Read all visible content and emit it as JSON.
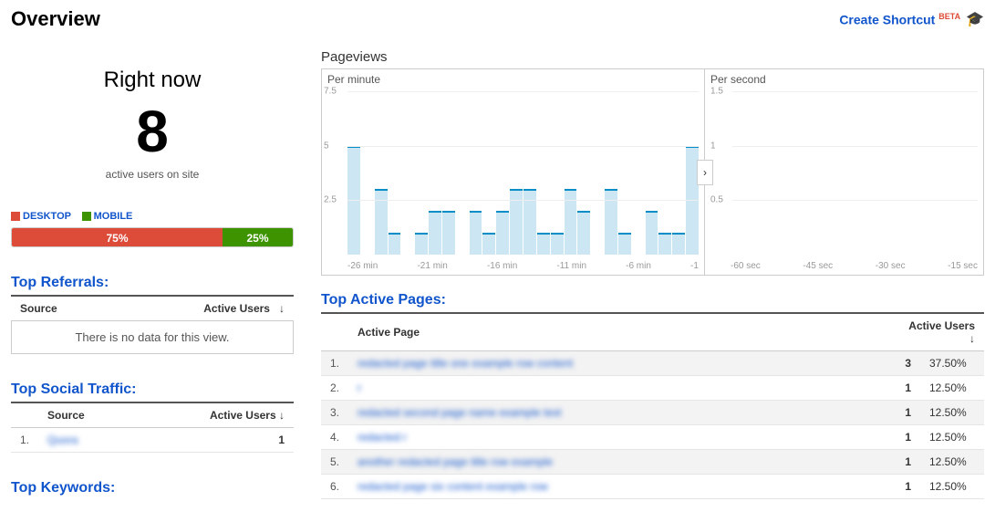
{
  "header": {
    "title": "Overview",
    "shortcut_label": "Create Shortcut",
    "beta_label": "BETA"
  },
  "rightnow": {
    "title": "Right now",
    "value": "8",
    "subtitle": "active users on site"
  },
  "platform": {
    "desktop_label": "DESKTOP",
    "mobile_label": "MOBILE",
    "desktop_pct": "75%",
    "mobile_pct": "25%",
    "desktop_width": 75,
    "mobile_width": 25
  },
  "sections": {
    "referrals": "Top Referrals:",
    "social": "Top Social Traffic:",
    "keywords": "Top Keywords:",
    "active_pages": "Top Active Pages:"
  },
  "columns": {
    "source": "Source",
    "active_users": "Active Users",
    "active_page": "Active Page",
    "sort_arrow": "↓"
  },
  "referrals": {
    "no_data": "There is no data for this view."
  },
  "social": {
    "rows": [
      {
        "idx": "1.",
        "source": "Quora",
        "users": "1"
      }
    ]
  },
  "charts": {
    "title": "Pageviews",
    "per_minute": "Per minute",
    "per_second": "Per second",
    "expand": "›"
  },
  "chart_data": [
    {
      "type": "bar",
      "title": "Per minute",
      "xlabel": "min",
      "ylabel": "",
      "ylim": [
        0,
        7.5
      ],
      "yticks": [
        2.5,
        5.0,
        7.5
      ],
      "xticks": [
        "-26 min",
        "-21 min",
        "-16 min",
        "-11 min",
        "-6 min",
        "-1"
      ],
      "values": [
        5,
        0,
        3,
        1,
        0,
        1,
        2,
        2,
        0,
        2,
        1,
        2,
        3,
        3,
        1,
        1,
        3,
        2,
        0,
        3,
        1,
        0,
        2,
        1,
        1,
        5
      ]
    },
    {
      "type": "bar",
      "title": "Per second",
      "xlabel": "sec",
      "ylabel": "",
      "ylim": [
        0,
        1.5
      ],
      "yticks": [
        0.5,
        1,
        1.5
      ],
      "xticks": [
        "-60 sec",
        "-45 sec",
        "-30 sec",
        "-15 sec"
      ],
      "values": []
    }
  ],
  "active_pages": {
    "rows": [
      {
        "idx": "1.",
        "page": "redacted page title one example row content",
        "users": "3",
        "pct": "37.50%"
      },
      {
        "idx": "2.",
        "page": "r",
        "users": "1",
        "pct": "12.50%"
      },
      {
        "idx": "3.",
        "page": "redacted second page name example text",
        "users": "1",
        "pct": "12.50%"
      },
      {
        "idx": "4.",
        "page": "redacted r",
        "users": "1",
        "pct": "12.50%"
      },
      {
        "idx": "5.",
        "page": "another redacted page title row example",
        "users": "1",
        "pct": "12.50%"
      },
      {
        "idx": "6.",
        "page": "redacted page six content example row",
        "users": "1",
        "pct": "12.50%"
      }
    ]
  }
}
